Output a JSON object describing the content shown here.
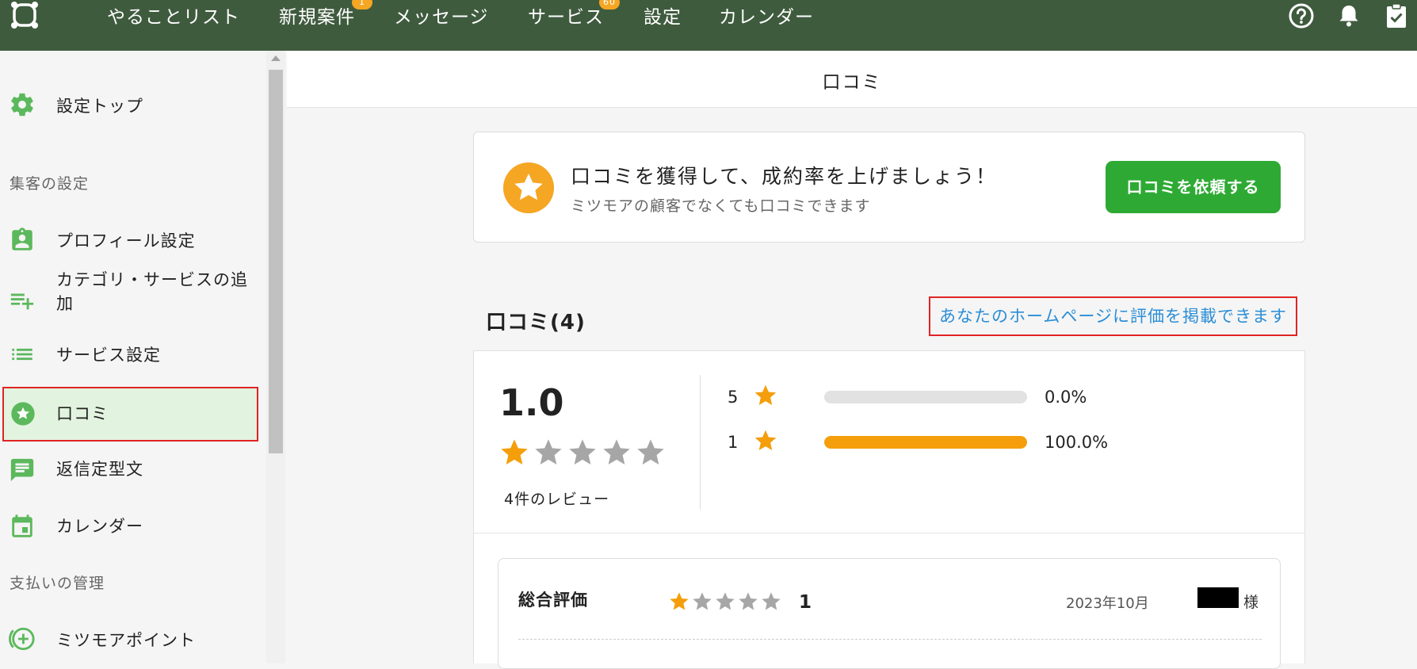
{
  "nav": {
    "items": [
      {
        "label": "やることリスト",
        "badge": ""
      },
      {
        "label": "新規案件",
        "badge": "1"
      },
      {
        "label": "メッセージ",
        "badge": ""
      },
      {
        "label": "サービス",
        "badge": "60"
      },
      {
        "label": "設定",
        "badge": ""
      },
      {
        "label": "カレンダー",
        "badge": ""
      }
    ],
    "icons": [
      "help-icon",
      "bell-icon",
      "clipboard-check-icon"
    ]
  },
  "sidebar": {
    "top_item": "設定トップ",
    "section_marketing": "集客の設定",
    "items": [
      {
        "label": "プロフィール設定",
        "icon": "profile-badge-icon"
      },
      {
        "label": "カテゴリ・サービスの追加",
        "icon": "playlist-add-icon"
      },
      {
        "label": "サービス設定",
        "icon": "list-icon"
      },
      {
        "label": "口コミ",
        "icon": "star-circle-icon"
      },
      {
        "label": "返信定型文",
        "icon": "message-icon"
      },
      {
        "label": "カレンダー",
        "icon": "calendar-icon"
      }
    ],
    "section_payment": "支払いの管理",
    "payment_item": "ミツモアポイント"
  },
  "main": {
    "title": "口コミ",
    "promo": {
      "title": "口コミを獲得して、成約率を上げましょう！",
      "subtitle": "ミツモアの顧客でなくても口コミできます",
      "button": "口コミを依頼する"
    },
    "reviews_heading": "口コミ(4)",
    "embed_link": "あなたのホームページに評価を掲載できます",
    "summary": {
      "average": "1.0",
      "average_value": 1.0,
      "count_label": "4件のレビュー",
      "distribution": [
        {
          "stars": "5",
          "fraction": 0.0,
          "percent": "0.0%"
        },
        {
          "stars": "1",
          "fraction": 1.0,
          "percent": "100.0%"
        }
      ]
    },
    "review": {
      "label": "総合評価",
      "rating": 1,
      "score": "1",
      "date": "2023年10月",
      "honorific": "様"
    }
  },
  "colors": {
    "nav_bg": "#3f5b3e",
    "accent_green": "#2eaa34",
    "icon_green": "#5cb85c",
    "star_orange": "#f59e0b",
    "link_blue": "#2b8ed6",
    "highlight_red": "#e02424"
  }
}
